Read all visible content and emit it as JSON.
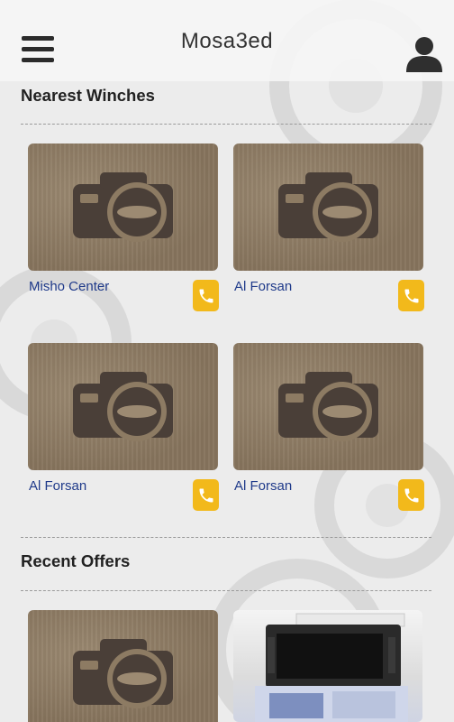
{
  "app": {
    "title": "Mosa3ed"
  },
  "icons": {
    "menu": "hamburger-icon",
    "profile": "user-icon",
    "placeholder": "camera-placeholder-icon",
    "call": "phone-icon"
  },
  "sections": {
    "nearest_winches": {
      "title": "Nearest Winches",
      "items": [
        {
          "name": "Misho Center"
        },
        {
          "name": "Al Forsan"
        },
        {
          "name": "Al Forsan"
        },
        {
          "name": "Al Forsan"
        }
      ]
    },
    "recent_offers": {
      "title": "Recent Offers",
      "items": [
        {
          "image": "camera-placeholder-icon"
        },
        {
          "image": "car-stereo-photo"
        }
      ]
    }
  },
  "colors": {
    "accent": "#f2b91b",
    "link": "#1f3a8a",
    "placeholder_bg": "#8d7b63",
    "placeholder_icon": "#4a3f38"
  }
}
